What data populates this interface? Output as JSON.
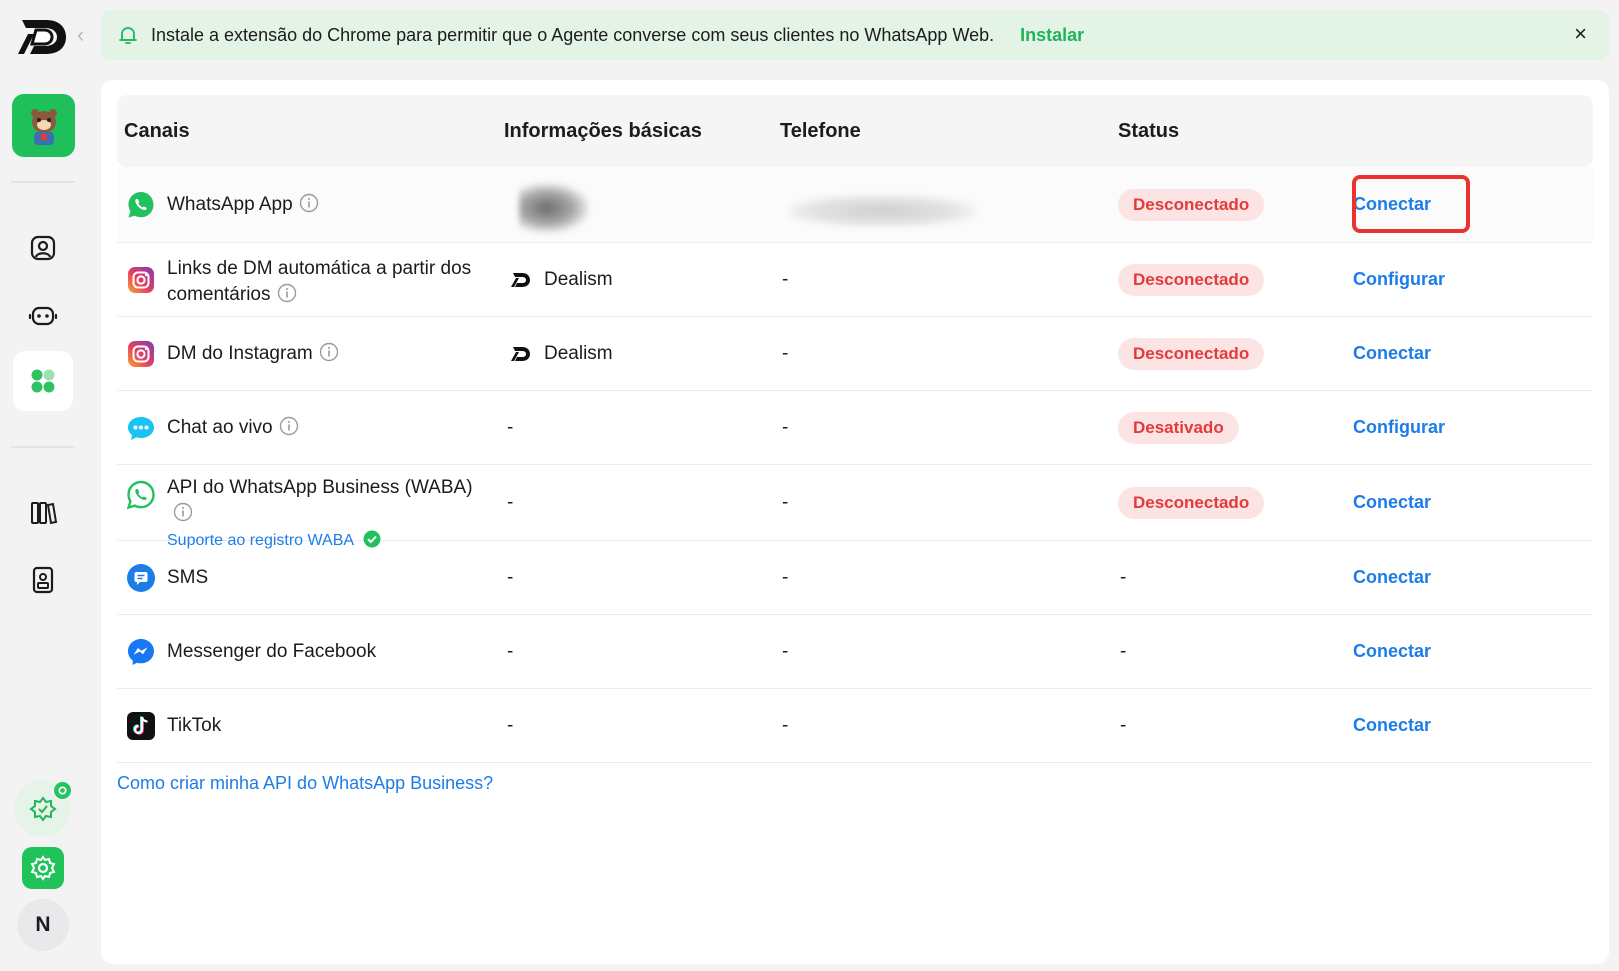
{
  "banner": {
    "text": "Instale a extensão do Chrome para permitir que o Agente converse com seus clientes no WhatsApp Web.",
    "link": "Instalar",
    "close": "×"
  },
  "sidebar": {
    "user_initial": "N",
    "items": [
      "contacts-icon",
      "bot-icon",
      "channels-icon",
      "library-icon",
      "phone-book-icon"
    ]
  },
  "table": {
    "headers": {
      "channels": "Canais",
      "basic_info": "Informações básicas",
      "phone": "Telefone",
      "status": "Status"
    },
    "rows": [
      {
        "icon": "whatsapp-icon",
        "name": "WhatsApp App",
        "basic": "",
        "phone": "",
        "status": "Desconectado",
        "action": "Conectar"
      },
      {
        "icon": "instagram-icon",
        "name_line1": "Links de DM automática a partir dos",
        "name_line2": "comentários",
        "basic": "Dealism",
        "phone": "-",
        "status": "Desconectado",
        "action": "Configurar"
      },
      {
        "icon": "instagram-icon",
        "name": "DM do Instagram",
        "basic": "Dealism",
        "phone": "-",
        "status": "Desconectado",
        "action": "Conectar"
      },
      {
        "icon": "live-chat-icon",
        "name": "Chat ao vivo",
        "basic": "-",
        "phone": "-",
        "status": "Desativado",
        "action": "Configurar"
      },
      {
        "icon": "whatsapp-business-icon",
        "name": "API do WhatsApp Business (WABA)",
        "sub": "Suporte ao registro WABA",
        "basic": "-",
        "phone": "-",
        "status": "Desconectado",
        "action": "Conectar"
      },
      {
        "icon": "sms-icon",
        "name": "SMS",
        "basic": "-",
        "phone": "-",
        "status": "-",
        "action": "Conectar"
      },
      {
        "icon": "messenger-icon",
        "name": "Messenger do Facebook",
        "basic": "-",
        "phone": "-",
        "status": "-",
        "action": "Conectar"
      },
      {
        "icon": "tiktok-icon",
        "name": "TikTok",
        "basic": "-",
        "phone": "-",
        "status": "-",
        "action": "Conectar"
      }
    ]
  },
  "footer": {
    "help_link": "Como criar minha API do WhatsApp Business?"
  },
  "colors": {
    "brand_green": "#21b35a",
    "link_blue": "#1d7de8",
    "danger": "#e23b3b",
    "highlight": "#e8332f"
  }
}
